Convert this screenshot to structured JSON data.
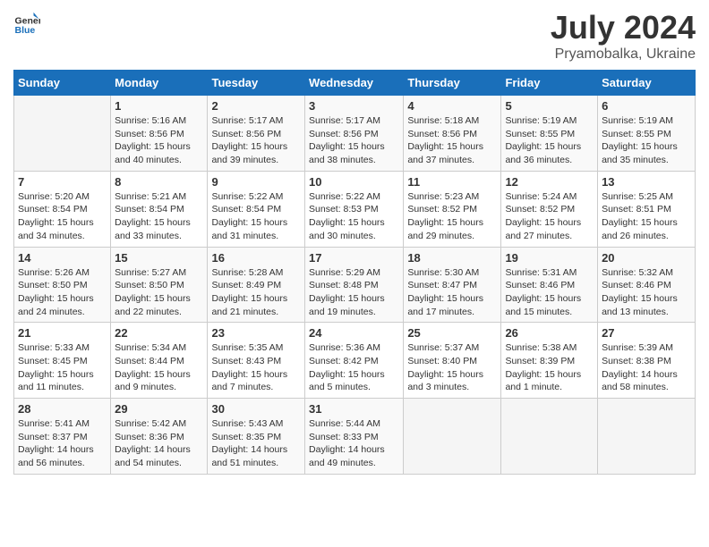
{
  "header": {
    "logo_general": "General",
    "logo_blue": "Blue",
    "title": "July 2024",
    "location": "Pryamobalka, Ukraine"
  },
  "calendar": {
    "days_of_week": [
      "Sunday",
      "Monday",
      "Tuesday",
      "Wednesday",
      "Thursday",
      "Friday",
      "Saturday"
    ],
    "weeks": [
      [
        {
          "day": "",
          "info": ""
        },
        {
          "day": "1",
          "info": "Sunrise: 5:16 AM\nSunset: 8:56 PM\nDaylight: 15 hours\nand 40 minutes."
        },
        {
          "day": "2",
          "info": "Sunrise: 5:17 AM\nSunset: 8:56 PM\nDaylight: 15 hours\nand 39 minutes."
        },
        {
          "day": "3",
          "info": "Sunrise: 5:17 AM\nSunset: 8:56 PM\nDaylight: 15 hours\nand 38 minutes."
        },
        {
          "day": "4",
          "info": "Sunrise: 5:18 AM\nSunset: 8:56 PM\nDaylight: 15 hours\nand 37 minutes."
        },
        {
          "day": "5",
          "info": "Sunrise: 5:19 AM\nSunset: 8:55 PM\nDaylight: 15 hours\nand 36 minutes."
        },
        {
          "day": "6",
          "info": "Sunrise: 5:19 AM\nSunset: 8:55 PM\nDaylight: 15 hours\nand 35 minutes."
        }
      ],
      [
        {
          "day": "7",
          "info": "Sunrise: 5:20 AM\nSunset: 8:54 PM\nDaylight: 15 hours\nand 34 minutes."
        },
        {
          "day": "8",
          "info": "Sunrise: 5:21 AM\nSunset: 8:54 PM\nDaylight: 15 hours\nand 33 minutes."
        },
        {
          "day": "9",
          "info": "Sunrise: 5:22 AM\nSunset: 8:54 PM\nDaylight: 15 hours\nand 31 minutes."
        },
        {
          "day": "10",
          "info": "Sunrise: 5:22 AM\nSunset: 8:53 PM\nDaylight: 15 hours\nand 30 minutes."
        },
        {
          "day": "11",
          "info": "Sunrise: 5:23 AM\nSunset: 8:52 PM\nDaylight: 15 hours\nand 29 minutes."
        },
        {
          "day": "12",
          "info": "Sunrise: 5:24 AM\nSunset: 8:52 PM\nDaylight: 15 hours\nand 27 minutes."
        },
        {
          "day": "13",
          "info": "Sunrise: 5:25 AM\nSunset: 8:51 PM\nDaylight: 15 hours\nand 26 minutes."
        }
      ],
      [
        {
          "day": "14",
          "info": "Sunrise: 5:26 AM\nSunset: 8:50 PM\nDaylight: 15 hours\nand 24 minutes."
        },
        {
          "day": "15",
          "info": "Sunrise: 5:27 AM\nSunset: 8:50 PM\nDaylight: 15 hours\nand 22 minutes."
        },
        {
          "day": "16",
          "info": "Sunrise: 5:28 AM\nSunset: 8:49 PM\nDaylight: 15 hours\nand 21 minutes."
        },
        {
          "day": "17",
          "info": "Sunrise: 5:29 AM\nSunset: 8:48 PM\nDaylight: 15 hours\nand 19 minutes."
        },
        {
          "day": "18",
          "info": "Sunrise: 5:30 AM\nSunset: 8:47 PM\nDaylight: 15 hours\nand 17 minutes."
        },
        {
          "day": "19",
          "info": "Sunrise: 5:31 AM\nSunset: 8:46 PM\nDaylight: 15 hours\nand 15 minutes."
        },
        {
          "day": "20",
          "info": "Sunrise: 5:32 AM\nSunset: 8:46 PM\nDaylight: 15 hours\nand 13 minutes."
        }
      ],
      [
        {
          "day": "21",
          "info": "Sunrise: 5:33 AM\nSunset: 8:45 PM\nDaylight: 15 hours\nand 11 minutes."
        },
        {
          "day": "22",
          "info": "Sunrise: 5:34 AM\nSunset: 8:44 PM\nDaylight: 15 hours\nand 9 minutes."
        },
        {
          "day": "23",
          "info": "Sunrise: 5:35 AM\nSunset: 8:43 PM\nDaylight: 15 hours\nand 7 minutes."
        },
        {
          "day": "24",
          "info": "Sunrise: 5:36 AM\nSunset: 8:42 PM\nDaylight: 15 hours\nand 5 minutes."
        },
        {
          "day": "25",
          "info": "Sunrise: 5:37 AM\nSunset: 8:40 PM\nDaylight: 15 hours\nand 3 minutes."
        },
        {
          "day": "26",
          "info": "Sunrise: 5:38 AM\nSunset: 8:39 PM\nDaylight: 15 hours\nand 1 minute."
        },
        {
          "day": "27",
          "info": "Sunrise: 5:39 AM\nSunset: 8:38 PM\nDaylight: 14 hours\nand 58 minutes."
        }
      ],
      [
        {
          "day": "28",
          "info": "Sunrise: 5:41 AM\nSunset: 8:37 PM\nDaylight: 14 hours\nand 56 minutes."
        },
        {
          "day": "29",
          "info": "Sunrise: 5:42 AM\nSunset: 8:36 PM\nDaylight: 14 hours\nand 54 minutes."
        },
        {
          "day": "30",
          "info": "Sunrise: 5:43 AM\nSunset: 8:35 PM\nDaylight: 14 hours\nand 51 minutes."
        },
        {
          "day": "31",
          "info": "Sunrise: 5:44 AM\nSunset: 8:33 PM\nDaylight: 14 hours\nand 49 minutes."
        },
        {
          "day": "",
          "info": ""
        },
        {
          "day": "",
          "info": ""
        },
        {
          "day": "",
          "info": ""
        }
      ]
    ]
  }
}
